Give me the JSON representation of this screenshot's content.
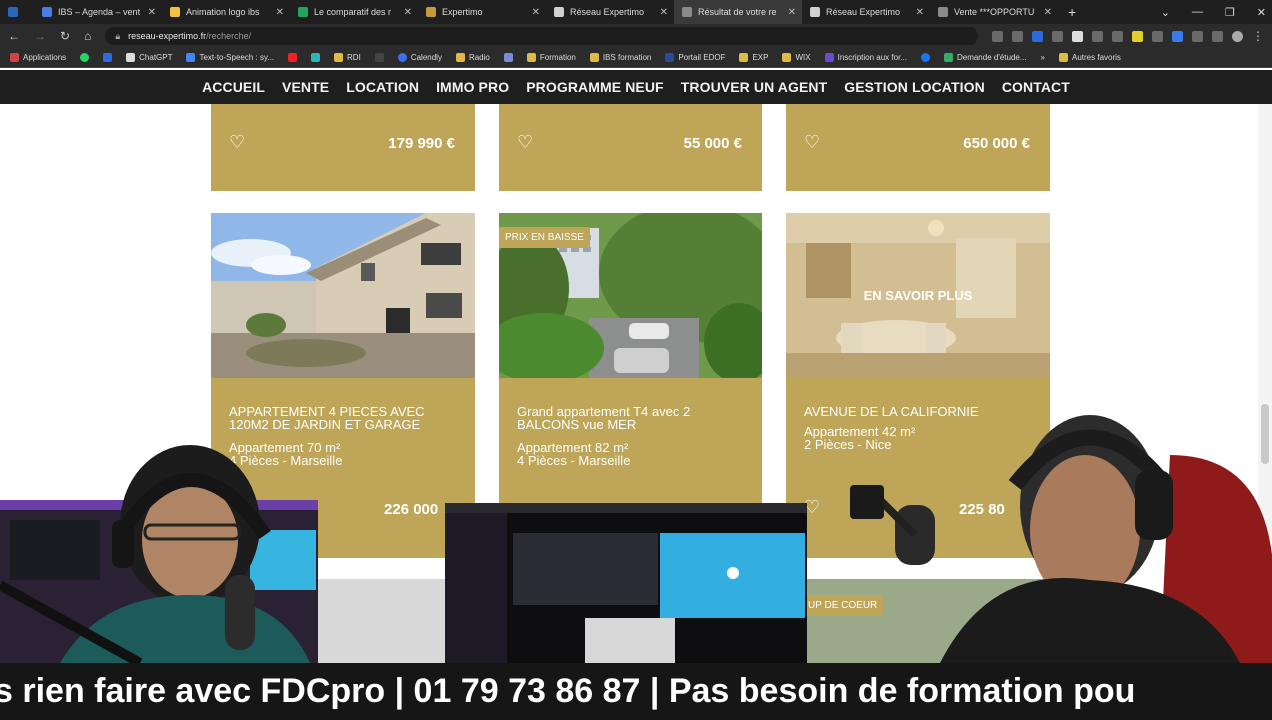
{
  "browser": {
    "tabs": [
      {
        "label": "",
        "active": false
      },
      {
        "label": "IBS – Agenda – vent",
        "active": false
      },
      {
        "label": "Animation logo ibs",
        "active": false
      },
      {
        "label": "Le comparatif des r",
        "active": false
      },
      {
        "label": "Expertimo",
        "active": false
      },
      {
        "label": "Réseau Expertimo",
        "active": false
      },
      {
        "label": "Résultat de votre re",
        "active": true
      },
      {
        "label": "Réseau Expertimo",
        "active": false
      },
      {
        "label": "Vente ***OPPORTU",
        "active": false
      }
    ],
    "url_host": "reseau-expertimo.fr",
    "url_path": "/recherche/",
    "bookmarks": [
      "Applications",
      "ChatGPT",
      "Text-to-Speech : sy...",
      "RDI",
      "Calendly",
      "Radio",
      "Formation",
      "IBS formation",
      "Portail EDOF",
      "EXP",
      "WIX",
      "Inscription aux for...",
      "Demande d'étude...",
      "Autres favoris"
    ]
  },
  "nav": {
    "items": [
      "ACCUEIL",
      "VENTE",
      "LOCATION",
      "IMMO PRO",
      "PROGRAMME NEUF",
      "TROUVER UN AGENT",
      "GESTION LOCATION",
      "CONTACT"
    ]
  },
  "listings_top": [
    {
      "price": "179 990 €"
    },
    {
      "price": "55 000 €"
    },
    {
      "price": "650 000 €"
    }
  ],
  "listings": [
    {
      "title": "APPARTEMENT 4 PIECES AVEC 120M2 DE JARDIN ET GARAGE",
      "type_line": "Appartement 70 m²",
      "rooms_line": "4 Pièces - Marseille",
      "price": "226 000",
      "badge": "",
      "overlay": ""
    },
    {
      "title": "Grand appartement T4 avec 2 BALCONS vue MER",
      "type_line": "Appartement 82 m²",
      "rooms_line": "4 Pièces - Marseille",
      "price": "",
      "badge": "PRIX EN BAISSE",
      "overlay": ""
    },
    {
      "title": "AVENUE DE LA CALIFORNIE",
      "type_line": "Appartement 42 m²",
      "rooms_line": "2 Pièces - Nice",
      "price": "225 80",
      "badge": "",
      "overlay": "EN SAVOIR PLUS"
    }
  ],
  "partial_badge": "UP DE COEUR",
  "ticker": "s rien faire avec FDCpro  | 01 79 73 86 87 | Pas besoin de formation pou",
  "colors": {
    "accent": "#bea557",
    "nav_bg": "#1e1e1e",
    "ticker_bg": "#161616"
  }
}
